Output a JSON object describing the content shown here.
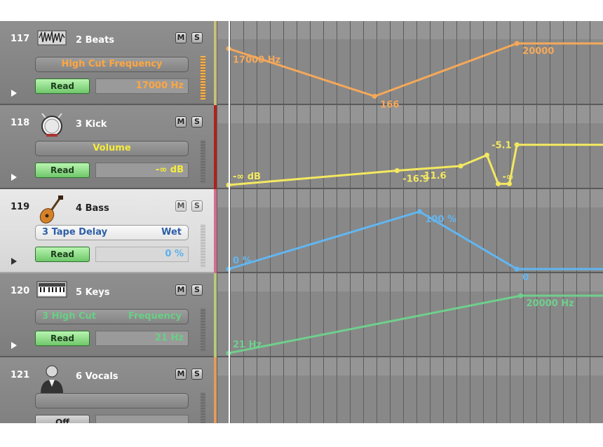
{
  "tracks": [
    {
      "number": "117",
      "name": "2 Beats",
      "icon": "waveform-icon",
      "mute": "M",
      "solo": "S",
      "param_left": "",
      "param_right": "",
      "param_center": "High Cut Frequency",
      "param_color": "#ffa640",
      "mode": "Read",
      "value": "17000 Hz",
      "value_color": "#ffa640",
      "color": "#c7c07a",
      "selected": false
    },
    {
      "number": "118",
      "name": "3 Kick",
      "icon": "drum-icon",
      "mute": "M",
      "solo": "S",
      "param_left": "",
      "param_right": "",
      "param_center": "Volume",
      "param_color": "#f6ec3a",
      "mode": "Read",
      "value": "-∞ dB",
      "value_color": "#f6ec3a",
      "color": "#b0221a",
      "selected": false
    },
    {
      "number": "119",
      "name": "4 Bass",
      "icon": "bass-guitar-icon",
      "mute": "M",
      "solo": "S",
      "param_left": "3 Tape Delay",
      "param_right": "Wet",
      "param_center": "",
      "param_color": "#2d5ea8",
      "mode": "Read",
      "value": "0 %",
      "value_color": "#5ab0ee",
      "color": "#d86c8e",
      "selected": true
    },
    {
      "number": "120",
      "name": "5 Keys",
      "icon": "keyboard-icon",
      "mute": "M",
      "solo": "S",
      "param_left": "3 High Cut",
      "param_right": "Frequency",
      "param_center": "",
      "param_color": "#68d084",
      "mode": "Read",
      "value": "21 Hz",
      "value_color": "#68d084",
      "color": "#b8c97a",
      "selected": false
    },
    {
      "number": "121",
      "name": "6 Vocals",
      "icon": "singer-icon",
      "mute": "M",
      "solo": "S",
      "param_left": "",
      "param_right": "",
      "param_center": "",
      "param_color": "#ffffff",
      "mode": "Off",
      "value": "",
      "value_color": "#ffffff",
      "color": "#e59a5a",
      "selected": false
    }
  ],
  "automation": [
    {
      "track": "117",
      "color": "#f5a85a",
      "points": [
        {
          "t": 0,
          "v": 0.91
        },
        {
          "t": 0.39,
          "v": 0.08
        },
        {
          "t": 0.77,
          "v": 1.0
        },
        {
          "t": 1.0,
          "v": 1.0
        }
      ],
      "labels": [
        {
          "i": 0,
          "text": "17000 Hz"
        },
        {
          "i": 1,
          "text": "166"
        },
        {
          "i": 2,
          "text": "20000"
        }
      ]
    },
    {
      "track": "118",
      "color": "#f3e860",
      "points": [
        {
          "t": 0,
          "v": 0
        },
        {
          "t": 0.45,
          "v": 0.25
        },
        {
          "t": 0.62,
          "v": 0.33
        },
        {
          "t": 0.69,
          "v": 0.52
        },
        {
          "t": 0.72,
          "v": 0.02
        },
        {
          "t": 0.75,
          "v": 0.02
        },
        {
          "t": 0.77,
          "v": 0.7
        },
        {
          "t": 1.0,
          "v": 0.7
        }
      ],
      "labels": [
        {
          "i": 0,
          "text": "-∞ dB"
        },
        {
          "i": 1,
          "text": "-16.9"
        },
        {
          "i": 2,
          "text": "-11.6"
        },
        {
          "i": 5,
          "text": "-∞"
        },
        {
          "i": 6,
          "text": "-5.1"
        }
      ]
    },
    {
      "track": "119",
      "color": "#62b6f0",
      "points": [
        {
          "t": 0,
          "v": 0
        },
        {
          "t": 0.51,
          "v": 1.0
        },
        {
          "t": 0.77,
          "v": 0
        },
        {
          "t": 1.0,
          "v": 0
        }
      ],
      "labels": [
        {
          "i": 0,
          "text": "0 %"
        },
        {
          "i": 1,
          "text": "100 %"
        },
        {
          "i": 2,
          "text": "0"
        }
      ]
    },
    {
      "track": "120",
      "color": "#6fcf8c",
      "points": [
        {
          "t": 0,
          "v": 0
        },
        {
          "t": 0.78,
          "v": 1.0
        },
        {
          "t": 1.0,
          "v": 1.0
        }
      ],
      "labels": [
        {
          "i": 0,
          "text": "21 Hz"
        },
        {
          "i": 1,
          "text": "20000 Hz"
        }
      ]
    }
  ]
}
